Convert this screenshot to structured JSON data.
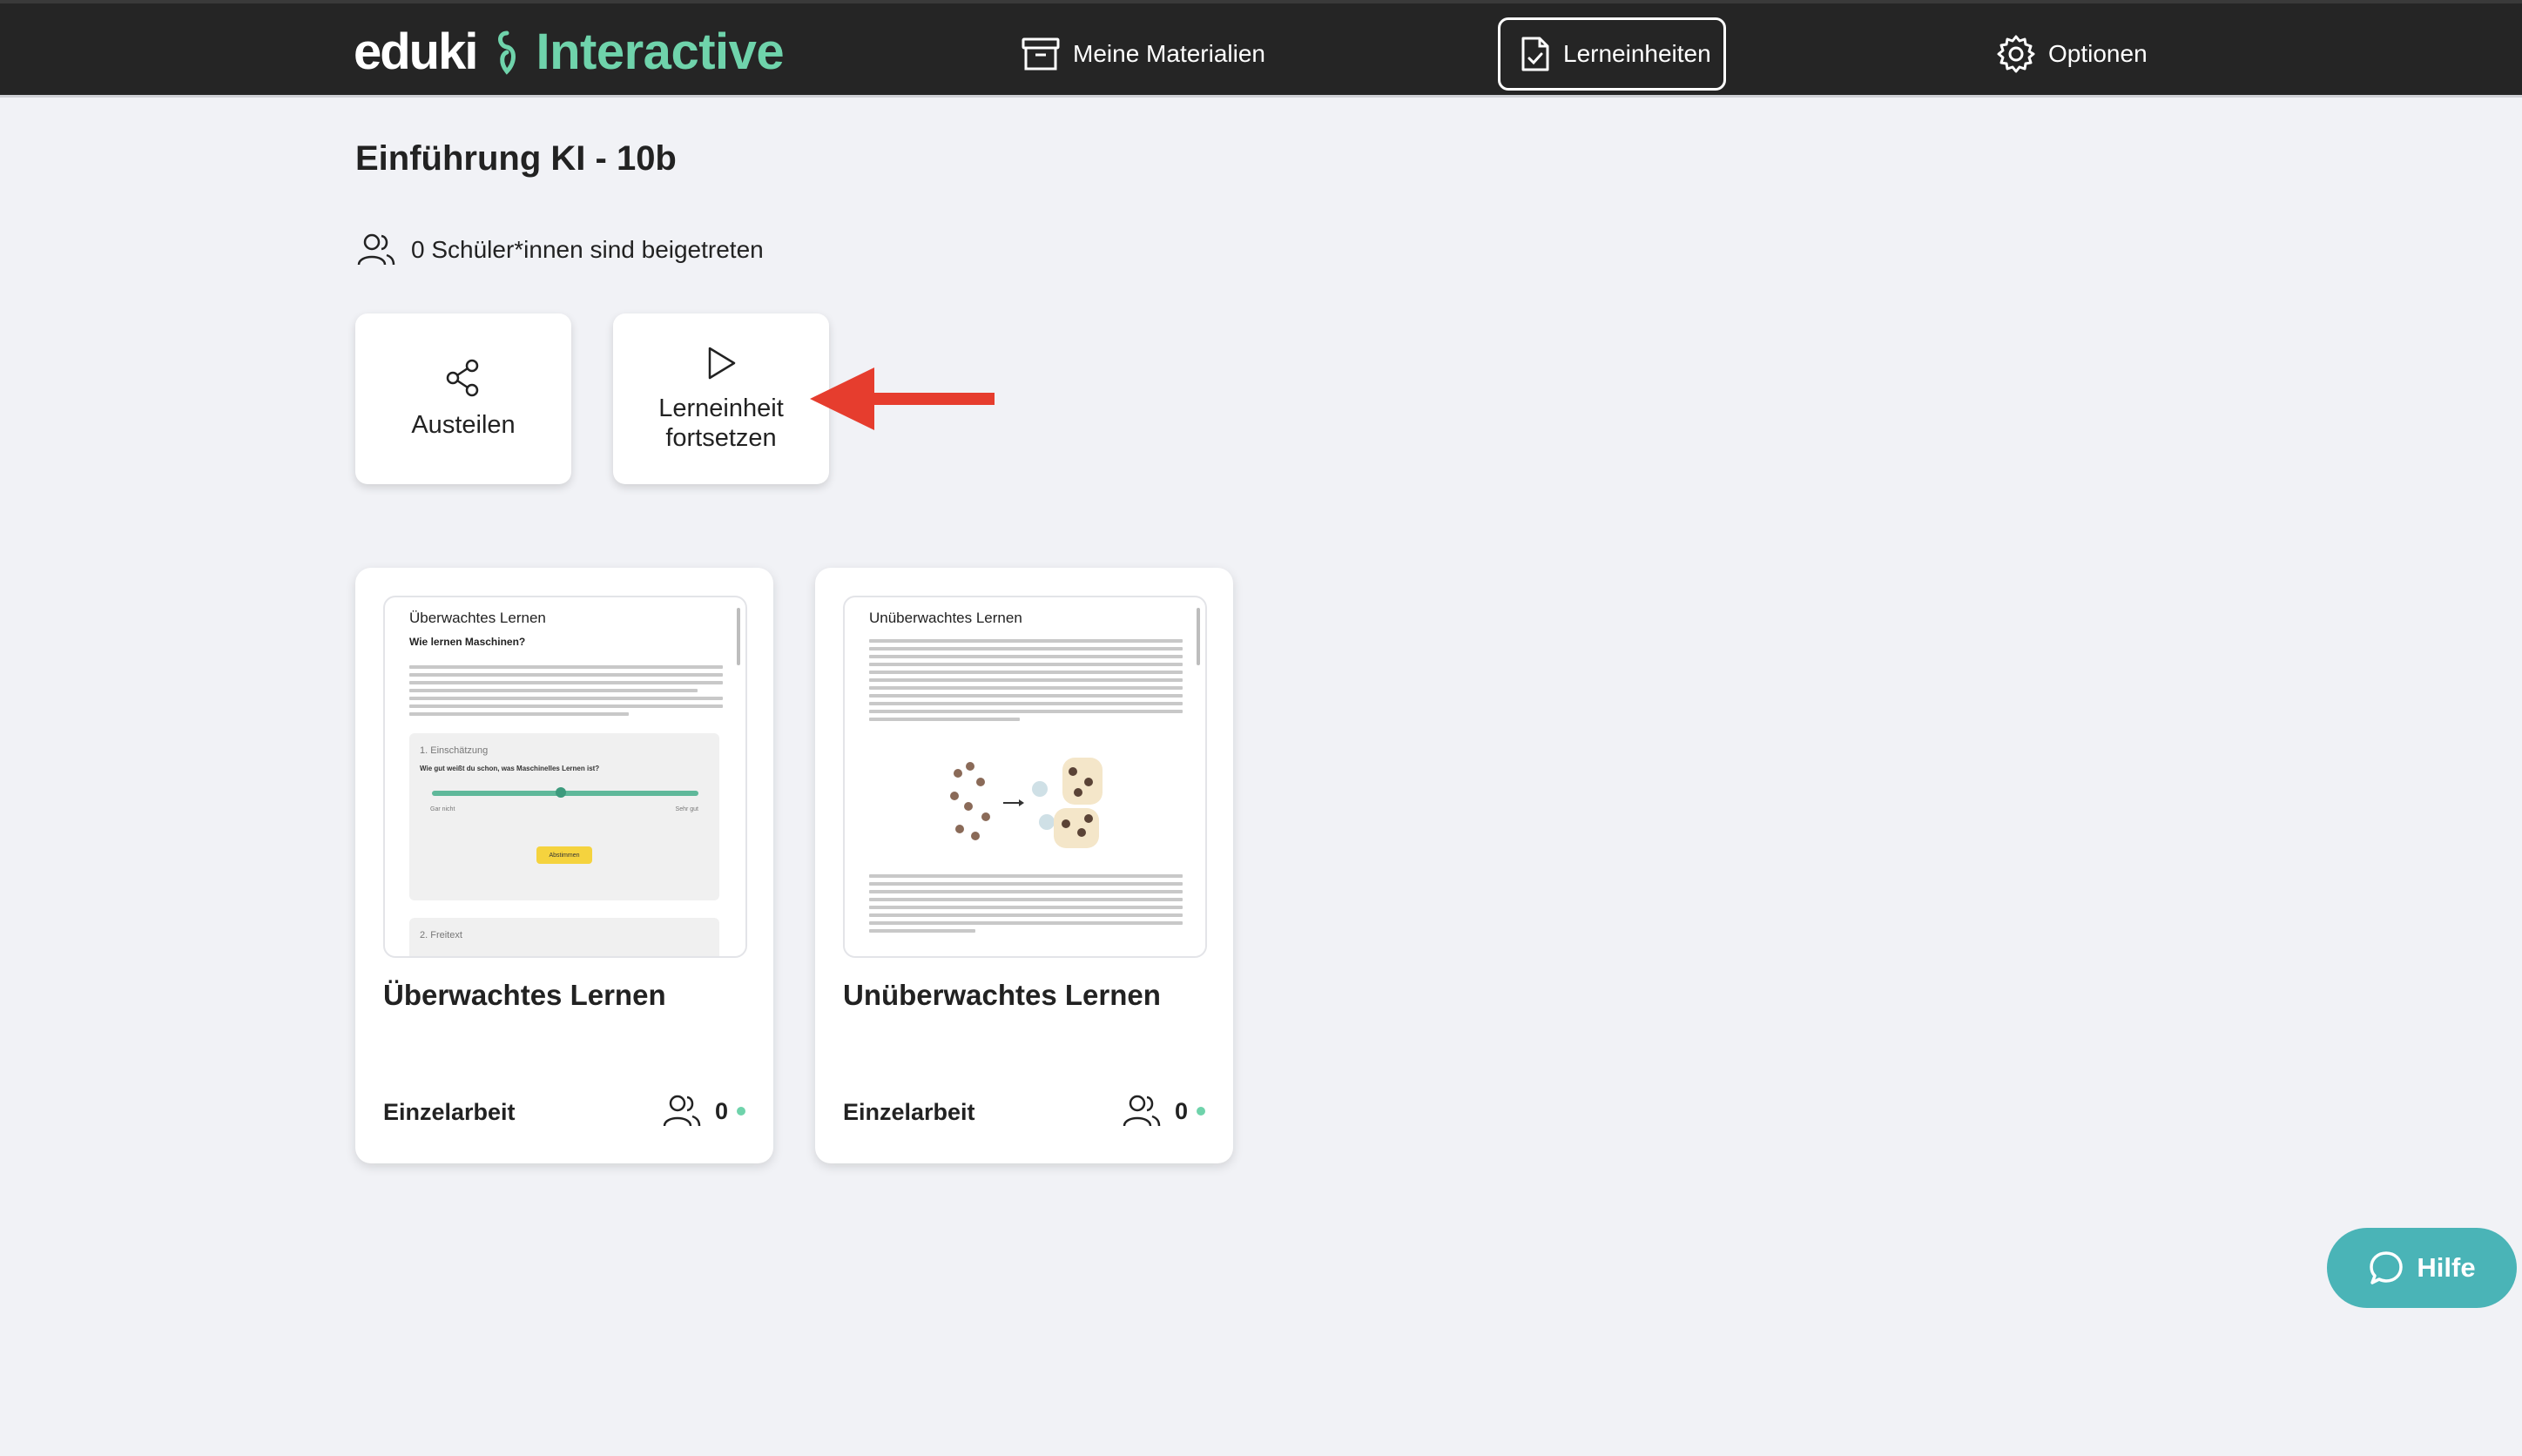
{
  "brand": {
    "part1": "eduki",
    "part2": "Interactive",
    "accent": "#6fd3ab"
  },
  "nav": {
    "materials": "Meine Materialien",
    "units": "Lerneinheiten",
    "options": "Optionen"
  },
  "page": {
    "title": "Einführung KI - 10b",
    "students_joined": "0 Schüler*innen sind beigetreten"
  },
  "actions": {
    "share": "Austeilen",
    "continue_line1": "Lerneinheit",
    "continue_line2": "fortsetzen"
  },
  "cards": [
    {
      "preview_title": "Überwachtes Lernen",
      "preview_heading": "Wie lernen Maschinen?",
      "preview_task1": "1. Einschätzung",
      "preview_question": "Wie gut weißt du schon, was Maschinelles Lernen ist?",
      "preview_low": "Gar nicht",
      "preview_high": "Sehr gut",
      "preview_button": "Abstimmen",
      "preview_task2": "2. Freitext",
      "title": "Überwachtes Lernen",
      "type": "Einzelarbeit",
      "count": "0"
    },
    {
      "preview_title": "Unüberwachtes Lernen",
      "title": "Unüberwachtes Lernen",
      "type": "Einzelarbeit",
      "count": "0"
    }
  ],
  "help": {
    "label": "Hilfe",
    "color": "#4ab4b7"
  }
}
